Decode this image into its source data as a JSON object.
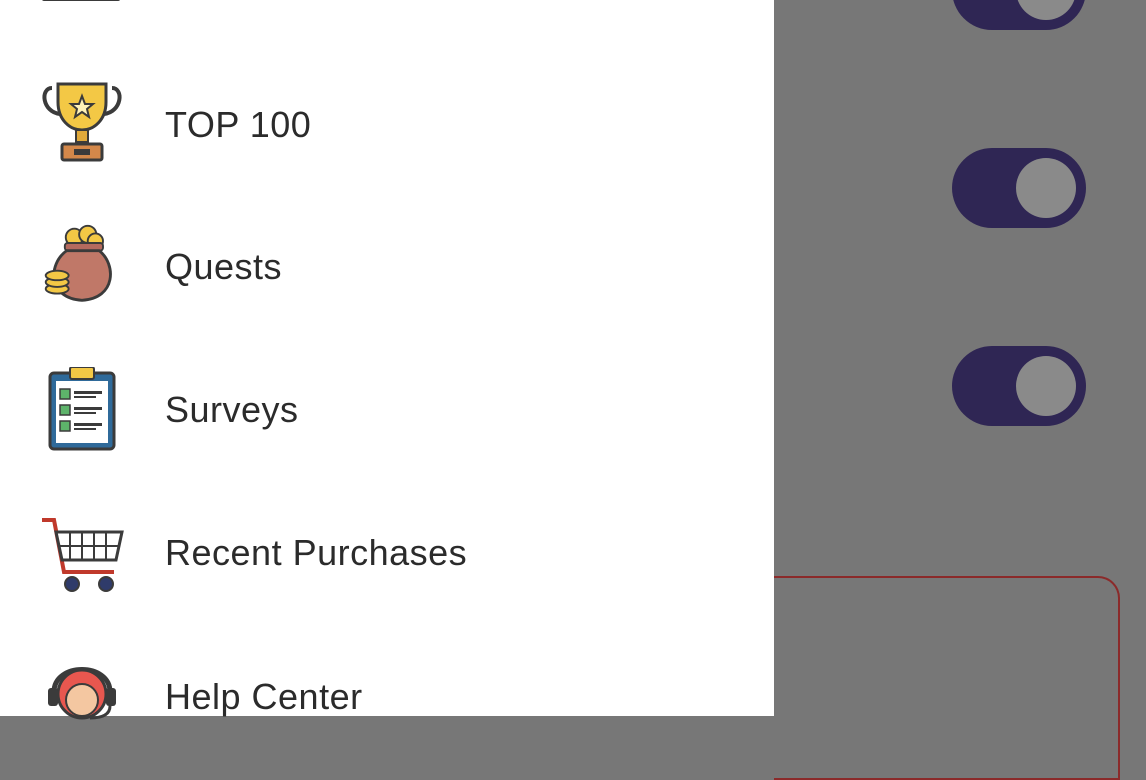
{
  "background": {
    "toggles": [
      {
        "state": "on"
      },
      {
        "state": "on"
      },
      {
        "state": "on"
      }
    ],
    "colors": {
      "scrim": "#777777",
      "toggle_track": "#2f2654",
      "card_border": "#8b2a2a"
    }
  },
  "drawer": {
    "items": [
      {
        "label": "",
        "icon": "laptop-icon"
      },
      {
        "label": "TOP 100",
        "icon": "trophy-icon"
      },
      {
        "label": "Quests",
        "icon": "money-bag-icon"
      },
      {
        "label": "Surveys",
        "icon": "clipboard-checklist-icon"
      },
      {
        "label": "Recent Purchases",
        "icon": "shopping-cart-icon"
      },
      {
        "label": "Help Center",
        "icon": "support-agent-icon"
      }
    ]
  }
}
